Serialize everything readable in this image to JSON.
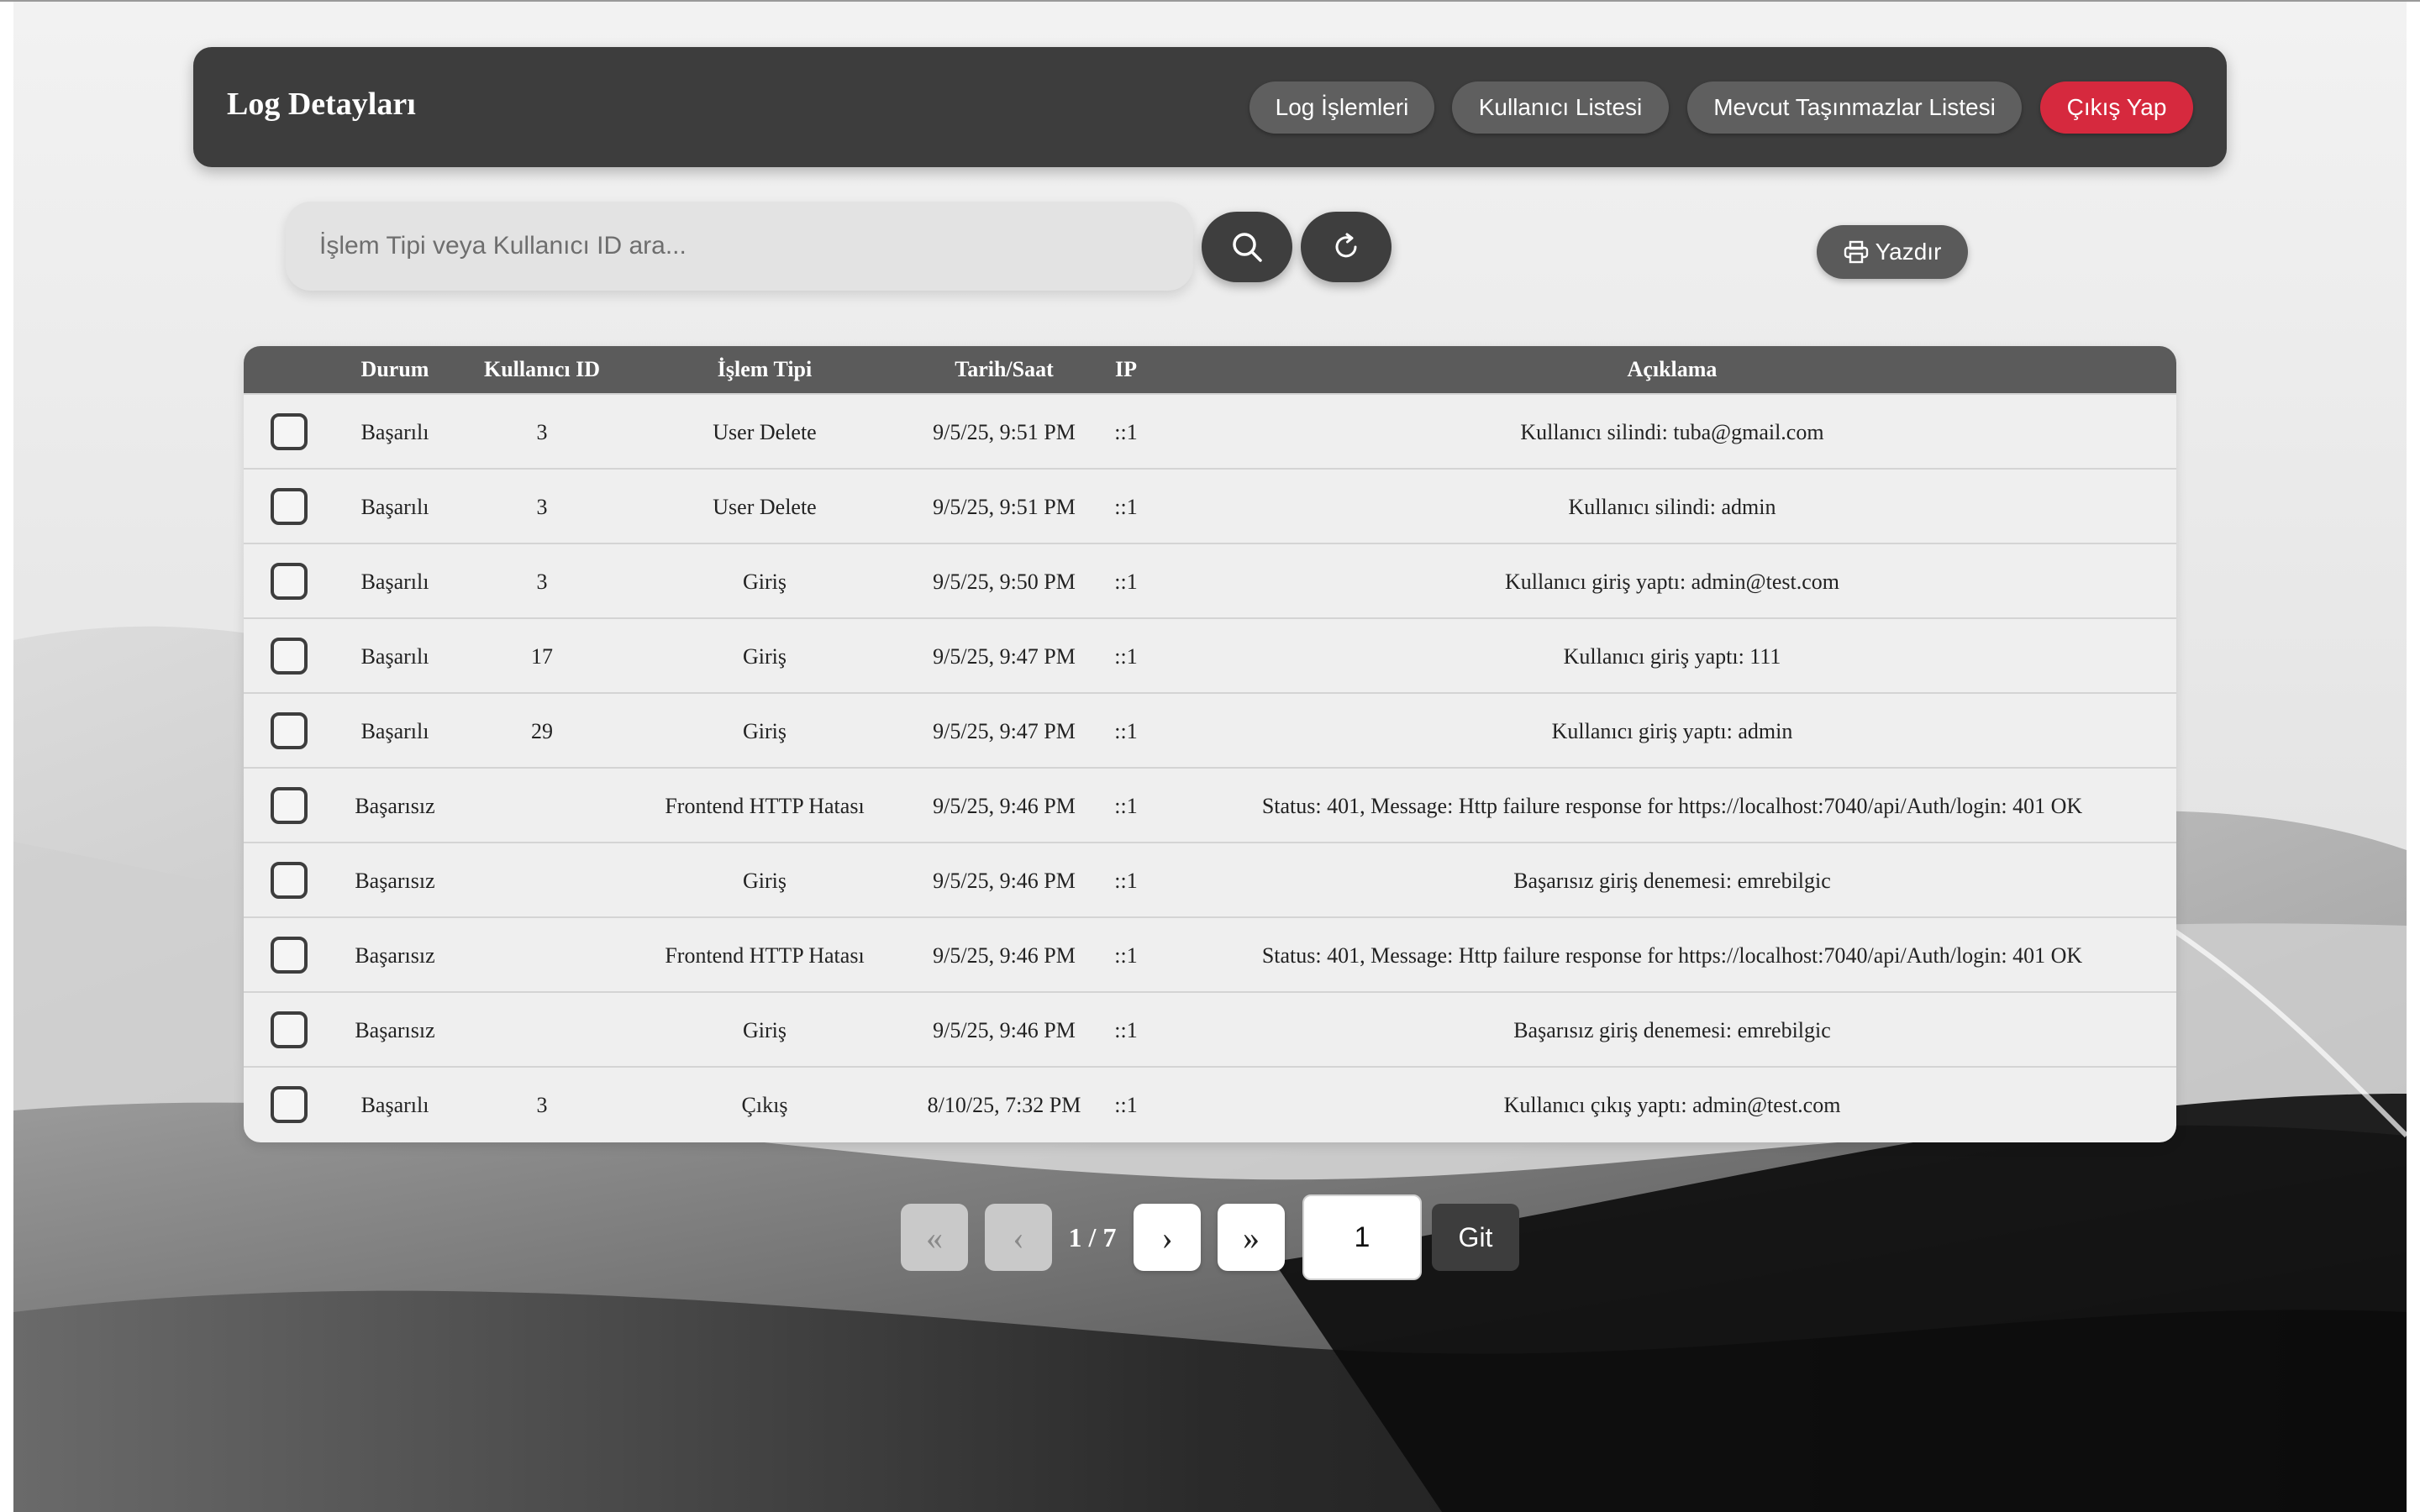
{
  "header": {
    "title": "Log Detayları",
    "nav": [
      "Log İşlemleri",
      "Kullanıcı Listesi",
      "Mevcut Taşınmazlar Listesi"
    ],
    "logout": "Çıkış Yap"
  },
  "search": {
    "placeholder": "İşlem Tipi veya Kullanıcı ID ara...",
    "value": "",
    "search_icon": "search-icon",
    "refresh_icon": "refresh-icon"
  },
  "print": {
    "label": "Yazdır",
    "icon": "printer-icon"
  },
  "table": {
    "columns": [
      "Durum",
      "Kullanıcı ID",
      "İşlem Tipi",
      "Tarih/Saat",
      "IP",
      "Açıklama"
    ],
    "rows": [
      {
        "durum": "Başarılı",
        "kullanici_id": "3",
        "islem_tipi": "User Delete",
        "tarih": "9/5/25, 9:51 PM",
        "ip": "::1",
        "aciklama": "Kullanıcı silindi: tuba@gmail.com"
      },
      {
        "durum": "Başarılı",
        "kullanici_id": "3",
        "islem_tipi": "User Delete",
        "tarih": "9/5/25, 9:51 PM",
        "ip": "::1",
        "aciklama": "Kullanıcı silindi: admin"
      },
      {
        "durum": "Başarılı",
        "kullanici_id": "3",
        "islem_tipi": "Giriş",
        "tarih": "9/5/25, 9:50 PM",
        "ip": "::1",
        "aciklama": "Kullanıcı giriş yaptı: admin@test.com"
      },
      {
        "durum": "Başarılı",
        "kullanici_id": "17",
        "islem_tipi": "Giriş",
        "tarih": "9/5/25, 9:47 PM",
        "ip": "::1",
        "aciklama": "Kullanıcı giriş yaptı: 111"
      },
      {
        "durum": "Başarılı",
        "kullanici_id": "29",
        "islem_tipi": "Giriş",
        "tarih": "9/5/25, 9:47 PM",
        "ip": "::1",
        "aciklama": "Kullanıcı giriş yaptı: admin"
      },
      {
        "durum": "Başarısız",
        "kullanici_id": "",
        "islem_tipi": "Frontend HTTP Hatası",
        "tarih": "9/5/25, 9:46 PM",
        "ip": "::1",
        "aciklama": "Status: 401, Message: Http failure response for https://localhost:7040/api/Auth/login: 401 OK"
      },
      {
        "durum": "Başarısız",
        "kullanici_id": "",
        "islem_tipi": "Giriş",
        "tarih": "9/5/25, 9:46 PM",
        "ip": "::1",
        "aciklama": "Başarısız giriş denemesi: emrebilgic"
      },
      {
        "durum": "Başarısız",
        "kullanici_id": "",
        "islem_tipi": "Frontend HTTP Hatası",
        "tarih": "9/5/25, 9:46 PM",
        "ip": "::1",
        "aciklama": "Status: 401, Message: Http failure response for https://localhost:7040/api/Auth/login: 401 OK"
      },
      {
        "durum": "Başarısız",
        "kullanici_id": "",
        "islem_tipi": "Giriş",
        "tarih": "9/5/25, 9:46 PM",
        "ip": "::1",
        "aciklama": "Başarısız giriş denemesi: emrebilgic"
      },
      {
        "durum": "Başarılı",
        "kullanici_id": "3",
        "islem_tipi": "Çıkış",
        "tarih": "8/10/25, 7:32 PM",
        "ip": "::1",
        "aciklama": "Kullanıcı çıkış yaptı: admin@test.com"
      }
    ]
  },
  "pagination": {
    "first": "«",
    "prev": "‹",
    "info": "1 / 7",
    "next": "›",
    "last": "»",
    "input_value": "1",
    "go": "Git"
  },
  "colors": {
    "navbar": "#3d3d3d",
    "logout": "#d6293e",
    "table_header": "#5b5b5b"
  }
}
